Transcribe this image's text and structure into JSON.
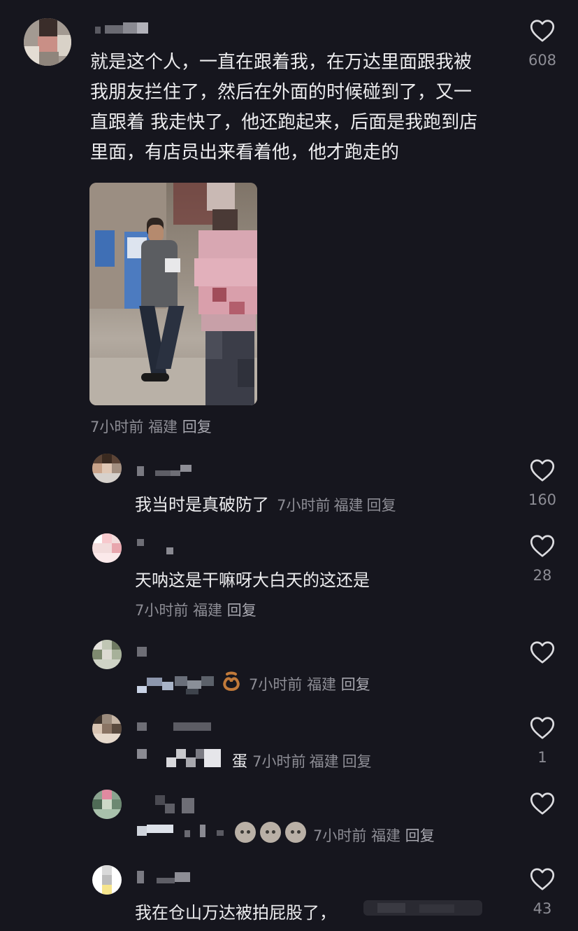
{
  "main_comment": {
    "lines": [
      "就是这个人，一直在跟着我，在万达里面跟我被",
      "我朋友拦住了，然后在外面的时候碰到了，又一",
      "直跟着 我走快了，他还跑起来，后面是我跑到店",
      "里面，有店员出来看着他，他才跑走的"
    ],
    "time": "7小时前",
    "location": "福建",
    "reply_label": "回复",
    "likes": "608"
  },
  "replies": [
    {
      "text": "我当时是真破防了",
      "time": "7小时前",
      "location": "福建",
      "reply_label": "回复",
      "likes": "160"
    },
    {
      "text": "天呐这是干嘛呀大白天的这还是",
      "time": "7小时前",
      "location": "福建",
      "reply_label": "回复",
      "likes": "28"
    },
    {
      "time": "7小时前",
      "location": "福建",
      "reply_label": "回复",
      "likes": ""
    },
    {
      "text_fragment": "蛋",
      "time": "7小时前",
      "location": "福建",
      "reply_label": "回复",
      "likes": "1"
    },
    {
      "time": "7小时前",
      "location": "福建",
      "reply_label": "回复",
      "likes": ""
    },
    {
      "text": "我在仓山万达被拍屁股了，",
      "likes": "43"
    }
  ],
  "icons": {
    "like": "heart-outline-icon",
    "emoji": "crying-face-emoji-icon",
    "sticker": "pretzel-emoji-icon"
  },
  "colors": {
    "background": "#16161e",
    "text": "#ececee",
    "meta": "#8d8d95"
  }
}
